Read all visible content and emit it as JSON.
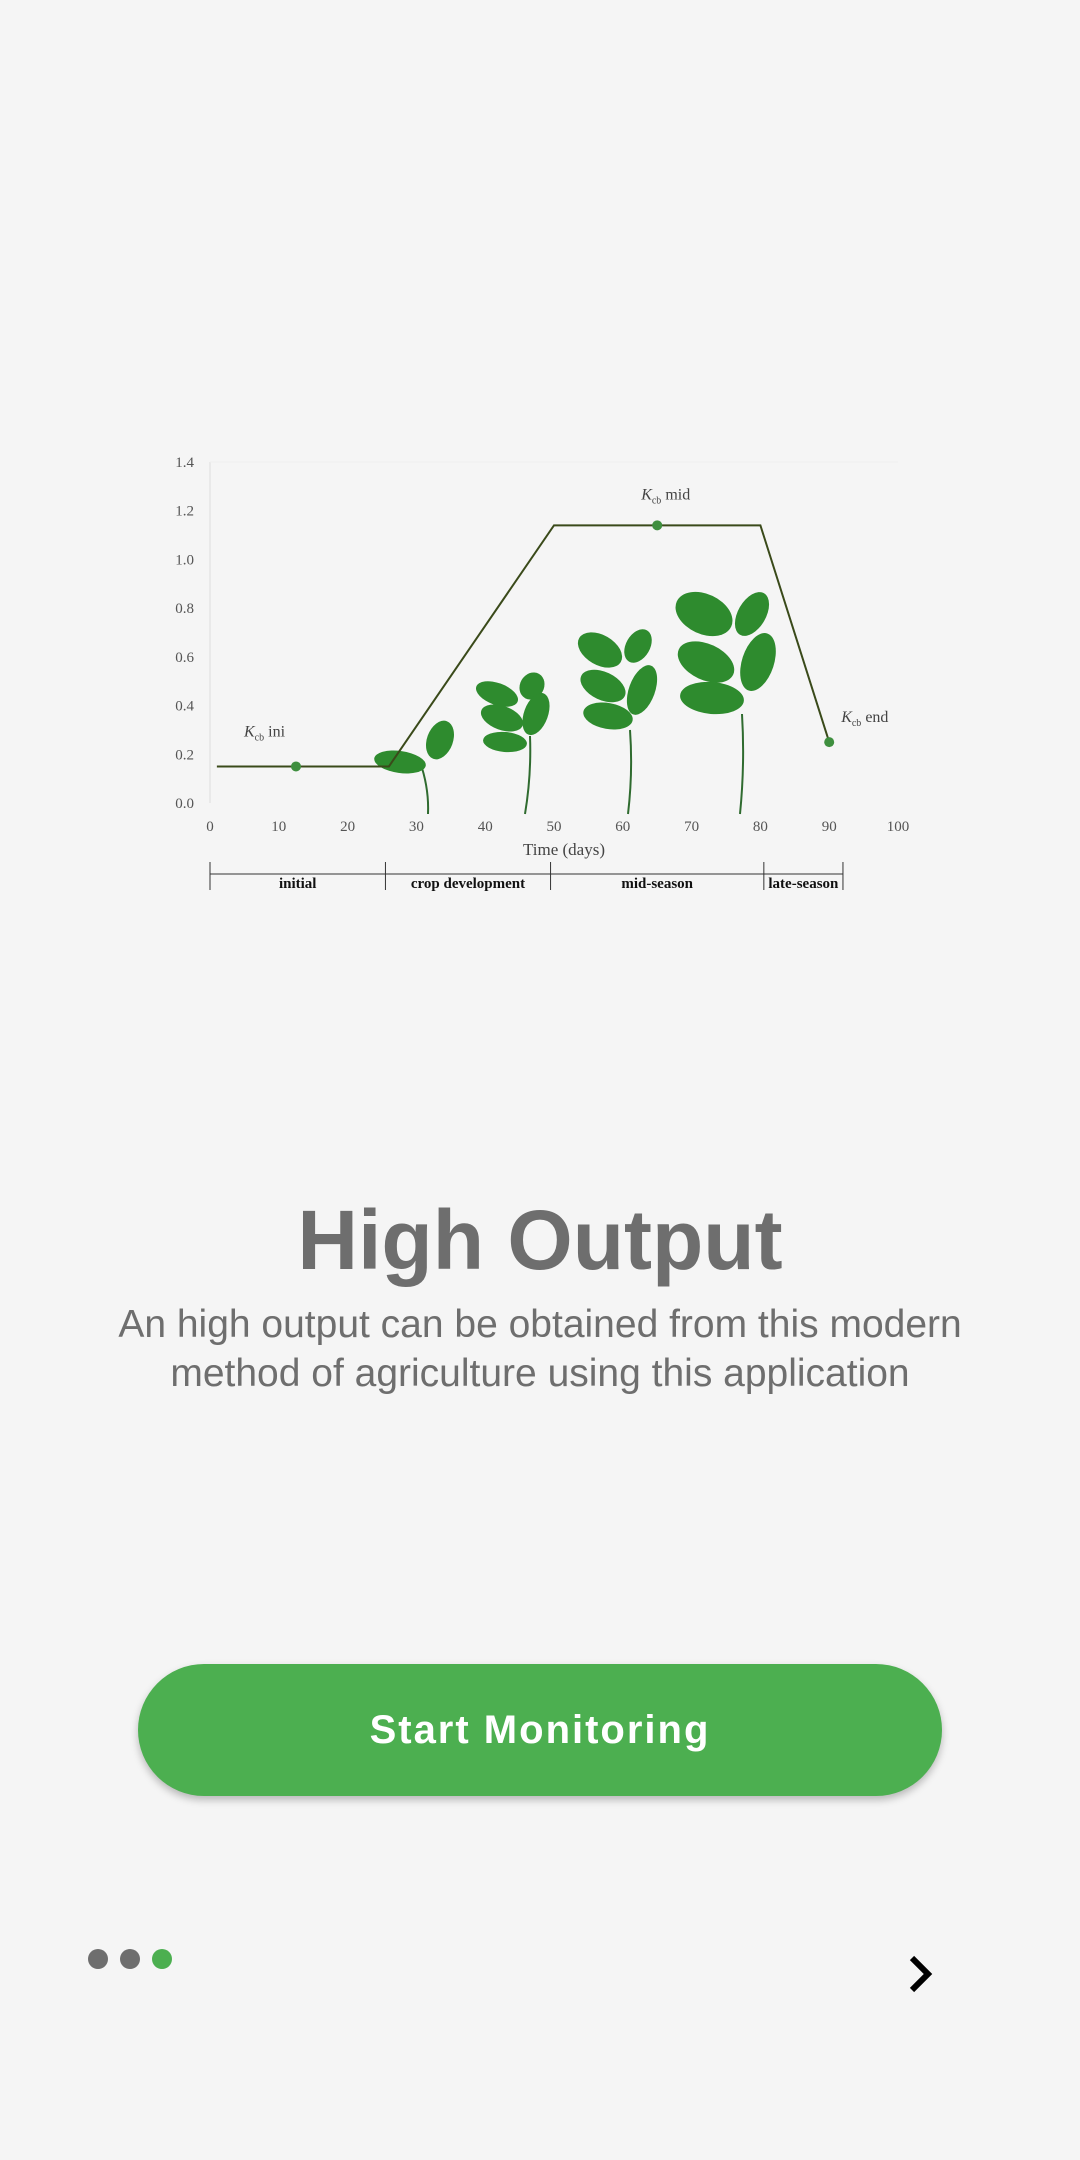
{
  "onboarding": {
    "title": "High Output",
    "description": "An high output can be obtained from this modern method of agriculture using this application",
    "start_button_label": "Start Monitoring",
    "page_indicator": {
      "total": 3,
      "current": 3
    },
    "next_icon": "chevron-right-icon",
    "accent_color": "#4caf50"
  },
  "chart_data": {
    "type": "line",
    "xlabel": "Time (days)",
    "ylabel": "",
    "xlim": [
      0,
      100
    ],
    "ylim": [
      0,
      1.4
    ],
    "x_ticks": [
      "0",
      "10",
      "20",
      "30",
      "40",
      "50",
      "60",
      "70",
      "80",
      "90",
      "100"
    ],
    "y_ticks": [
      "0.0",
      "0.2",
      "0.4",
      "0.6",
      "0.8",
      "1.0",
      "1.2",
      "1.4"
    ],
    "series": [
      {
        "x": [
          1,
          26,
          50,
          80,
          90
        ],
        "y": [
          0.15,
          0.15,
          1.14,
          1.14,
          0.25
        ]
      }
    ],
    "points": [
      {
        "label_main": "K",
        "label_sub": "cb",
        "label_tail": " ini",
        "x": 12.5,
        "y": 0.15
      },
      {
        "label_main": "K",
        "label_sub": "cb",
        "label_tail": " mid",
        "x": 65,
        "y": 1.14
      },
      {
        "label_main": "K",
        "label_sub": "cb",
        "label_tail": " end",
        "x": 90,
        "y": 0.25
      }
    ],
    "stages": [
      {
        "name": "initial",
        "start": 0,
        "end": 25.5
      },
      {
        "name": "crop development",
        "start": 25.5,
        "end": 49.5
      },
      {
        "name": "mid-season",
        "start": 49.5,
        "end": 80.5
      },
      {
        "name": "late-season",
        "start": 80.5,
        "end": 92
      }
    ],
    "line_color": "#3a4a1a",
    "point_color": "#3f8f3f",
    "plant_color": "#2e8b2e"
  }
}
